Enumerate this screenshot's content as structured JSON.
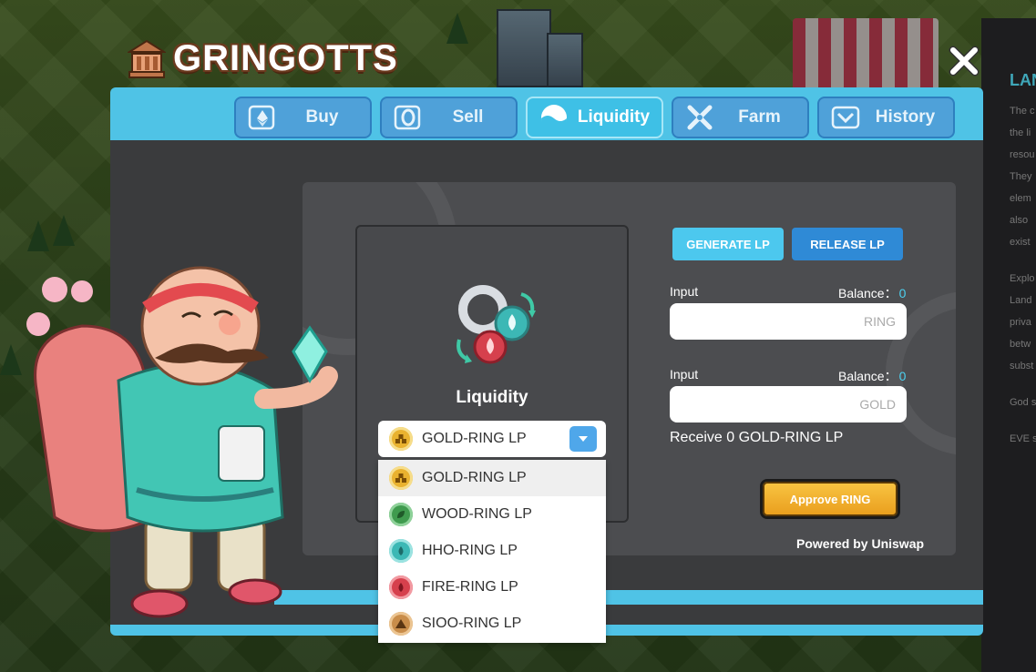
{
  "app": {
    "logo_text": "GRINGOTTS",
    "close_icon": "close-icon"
  },
  "tabs": [
    {
      "label": "Buy",
      "icon": "eth-exchange-icon",
      "active": false
    },
    {
      "label": "Sell",
      "icon": "ring-exchange-icon",
      "active": false
    },
    {
      "label": "Liquidity",
      "icon": "liquidity-icon",
      "active": true
    },
    {
      "label": "Farm",
      "icon": "windmill-icon",
      "active": false
    },
    {
      "label": "History",
      "icon": "history-icon",
      "active": false
    }
  ],
  "liquidity": {
    "title": "Liquidity",
    "selected_pair": "GOLD-RING LP",
    "pairs": [
      {
        "label": "GOLD-RING LP",
        "icon": "gold-token-icon",
        "color": "#e9b22f"
      },
      {
        "label": "WOOD-RING LP",
        "icon": "wood-token-icon",
        "color": "#3f9b4e"
      },
      {
        "label": "HHO-RING LP",
        "icon": "hho-token-icon",
        "color": "#3cb8b5"
      },
      {
        "label": "FIRE-RING LP",
        "icon": "fire-token-icon",
        "color": "#d6404d"
      },
      {
        "label": "SIOO-RING LP",
        "icon": "sioo-token-icon",
        "color": "#c98d4a"
      }
    ]
  },
  "form": {
    "generate_label": "GENERATE LP",
    "release_label": "RELEASE LP",
    "input1": {
      "label": "Input",
      "balance_label": "Balance：",
      "balance_value": "0",
      "placeholder": "RING"
    },
    "input2": {
      "label": "Input",
      "balance_label": "Balance：",
      "balance_value": "0",
      "placeholder": "GOLD"
    },
    "receive_text": "Receive 0 GOLD-RING LP",
    "approve_label": "Approve RING",
    "powered_by": "Powered by Uniswap"
  },
  "side_panel": {
    "title": "LAN",
    "lines": [
      "The c",
      "the li",
      "resou",
      "They",
      "elem",
      "also",
      "exist",
      "Explo",
      "Land",
      "priva",
      "betw",
      "subst",
      "God s",
      "EVE s"
    ]
  },
  "colors": {
    "frame": "#4fc3e6",
    "tab": "#4fa1d9",
    "tab_active": "#3ec0e6",
    "generate": "#4cc8ee",
    "release": "#2f8ad6",
    "approve": "#f2b22e",
    "balance": "#4cd1f0"
  }
}
